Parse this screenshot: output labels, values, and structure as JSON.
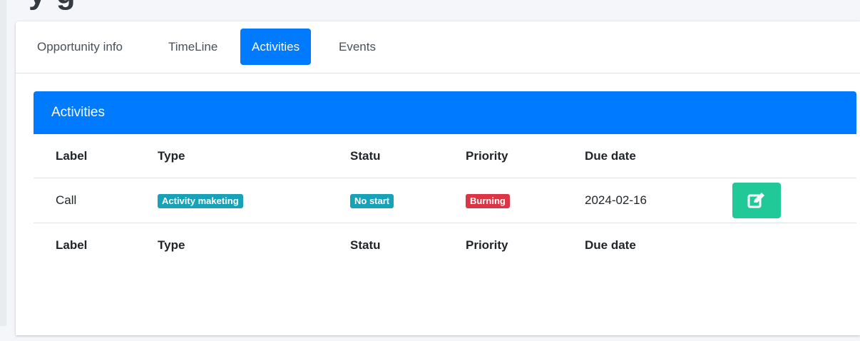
{
  "page": {
    "title_partial": "y g"
  },
  "tabs": [
    {
      "label": "Opportunity info",
      "active": false
    },
    {
      "label": "TimeLine",
      "active": false
    },
    {
      "label": "Activities",
      "active": true
    },
    {
      "label": "Events",
      "active": false
    }
  ],
  "activities": {
    "header": "Activities",
    "columns": [
      "Label",
      "Type",
      "Statu",
      "Priority",
      "Due date"
    ],
    "rows": [
      {
        "label": "Call",
        "type": "Activity maketing",
        "status": "No start",
        "priority": "Burning",
        "due_date": "2024-02-16",
        "action_icon": "edit-icon"
      }
    ],
    "footer_columns": [
      "Label",
      "Type",
      "Statu",
      "Priority",
      "Due date"
    ]
  },
  "colors": {
    "primary": "#007bff",
    "badge_info": "#17a2b8",
    "badge_danger": "#dc3545",
    "edit_button": "#20c997"
  }
}
